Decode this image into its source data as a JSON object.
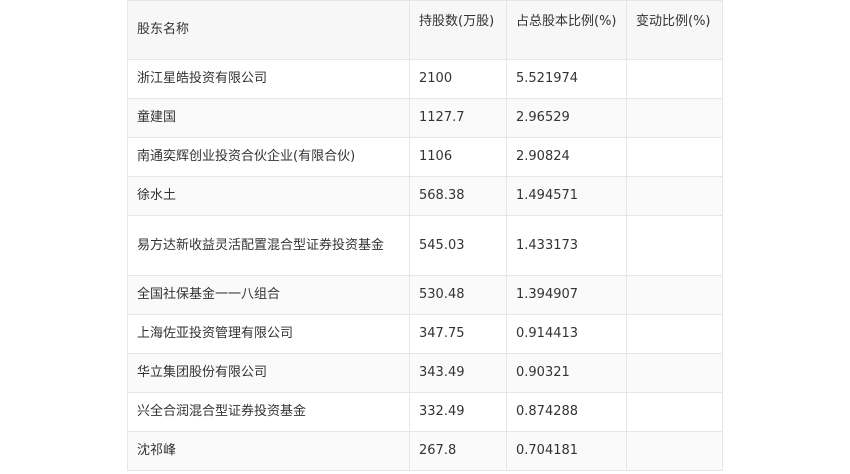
{
  "table": {
    "headers": {
      "name": "股东名称",
      "shares": "持股数(万股)",
      "ratio": "占总股本比例(%)",
      "change": "变动比例(%)"
    },
    "rows": [
      {
        "name": "浙江星皓投资有限公司",
        "shares": "2100",
        "ratio": "5.521974",
        "change": ""
      },
      {
        "name": "童建国",
        "shares": "1127.7",
        "ratio": "2.96529",
        "change": ""
      },
      {
        "name": "南通奕辉创业投资合伙企业(有限合伙)",
        "shares": "1106",
        "ratio": "2.90824",
        "change": ""
      },
      {
        "name": "徐水土",
        "shares": "568.38",
        "ratio": "1.494571",
        "change": ""
      },
      {
        "name": "易方达新收益灵活配置混合型证券投资基金",
        "shares": "545.03",
        "ratio": "1.433173",
        "change": ""
      },
      {
        "name": "全国社保基金一一八组合",
        "shares": "530.48",
        "ratio": "1.394907",
        "change": ""
      },
      {
        "name": "上海佐亚投资管理有限公司",
        "shares": "347.75",
        "ratio": "0.914413",
        "change": ""
      },
      {
        "name": "华立集团股份有限公司",
        "shares": "343.49",
        "ratio": "0.90321",
        "change": ""
      },
      {
        "name": "兴全合润混合型证券投资基金",
        "shares": "332.49",
        "ratio": "0.874288",
        "change": ""
      },
      {
        "name": "沈祁峰",
        "shares": "267.8",
        "ratio": "0.704181",
        "change": ""
      }
    ]
  }
}
